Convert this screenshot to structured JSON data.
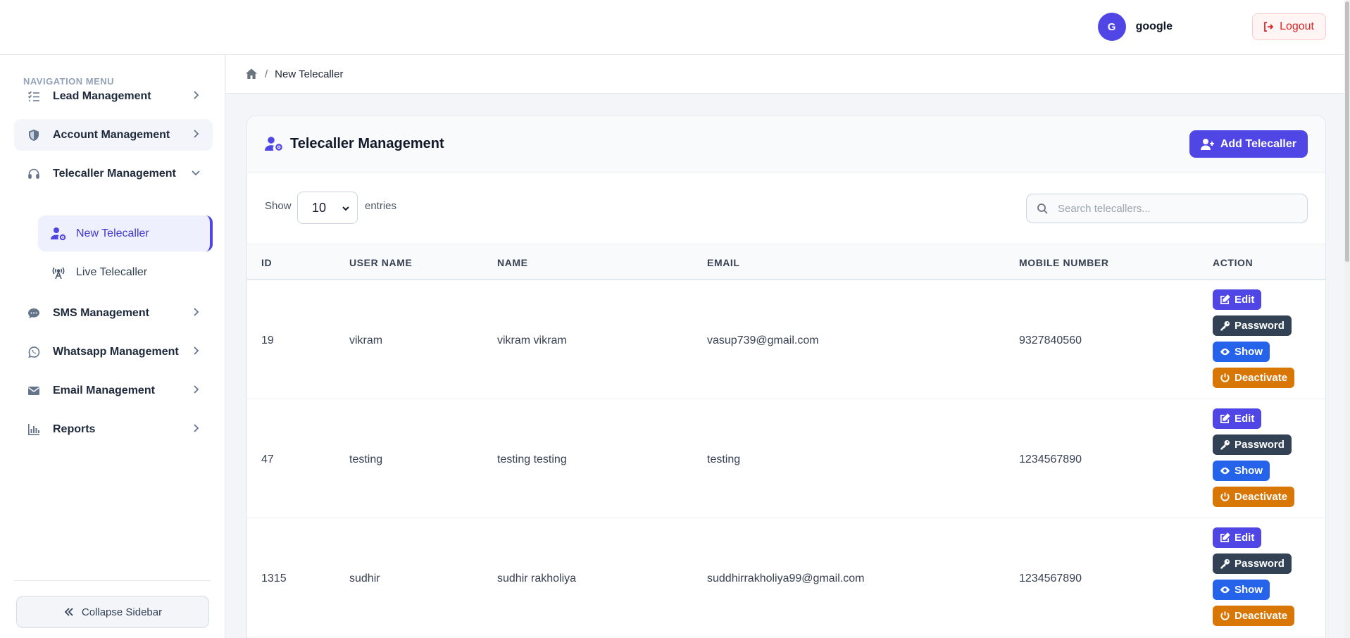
{
  "header": {
    "avatar_initial": "G",
    "username": "google",
    "logout_label": "Logout"
  },
  "sidebar": {
    "heading": "NAVIGATION MENU",
    "items": [
      {
        "label": "Lead Management",
        "icon": "list-check-icon"
      },
      {
        "label": "Account Management",
        "icon": "shield-icon"
      },
      {
        "label": "Telecaller Management",
        "icon": "headset-icon",
        "expanded": true
      },
      {
        "label": "SMS Management",
        "icon": "sms-icon"
      },
      {
        "label": "Whatsapp Management",
        "icon": "whatsapp-icon"
      },
      {
        "label": "Email Management",
        "icon": "envelope-icon"
      },
      {
        "label": "Reports",
        "icon": "bar-chart-icon"
      }
    ],
    "subitems": [
      {
        "label": "New Telecaller",
        "icon": "user-gear-icon",
        "active": true
      },
      {
        "label": "Live Telecaller",
        "icon": "broadcast-tower-icon"
      }
    ],
    "collapse_label": "Collapse Sidebar"
  },
  "breadcrumb": {
    "current": "New Telecaller"
  },
  "card": {
    "title": "Telecaller Management",
    "add_label": "Add Telecaller"
  },
  "controls": {
    "show_label": "Show",
    "entries_value": "10",
    "entries_label": "entries",
    "search_placeholder": "Search telecallers..."
  },
  "table": {
    "columns": [
      "ID",
      "USER NAME",
      "NAME",
      "EMAIL",
      "MOBILE NUMBER",
      "ACTION"
    ],
    "rows": [
      {
        "id": "19",
        "username": "vikram",
        "name": "vikram vikram",
        "email": "vasup739@gmail.com",
        "mobile": "9327840560"
      },
      {
        "id": "47",
        "username": "testing",
        "name": "testing testing",
        "email": "testing",
        "mobile": "1234567890"
      },
      {
        "id": "1315",
        "username": "sudhir",
        "name": "sudhir rakholiya",
        "email": "suddhirrakholiya99@gmail.com",
        "mobile": "1234567890"
      }
    ],
    "actions": {
      "edit": "Edit",
      "password": "Password",
      "show": "Show",
      "deactivate": "Deactivate"
    }
  },
  "colors": {
    "accent": "#4f46e5",
    "password": "#334155",
    "show": "#2563eb",
    "deactivate": "#d97706",
    "logout": "#dc2626"
  }
}
